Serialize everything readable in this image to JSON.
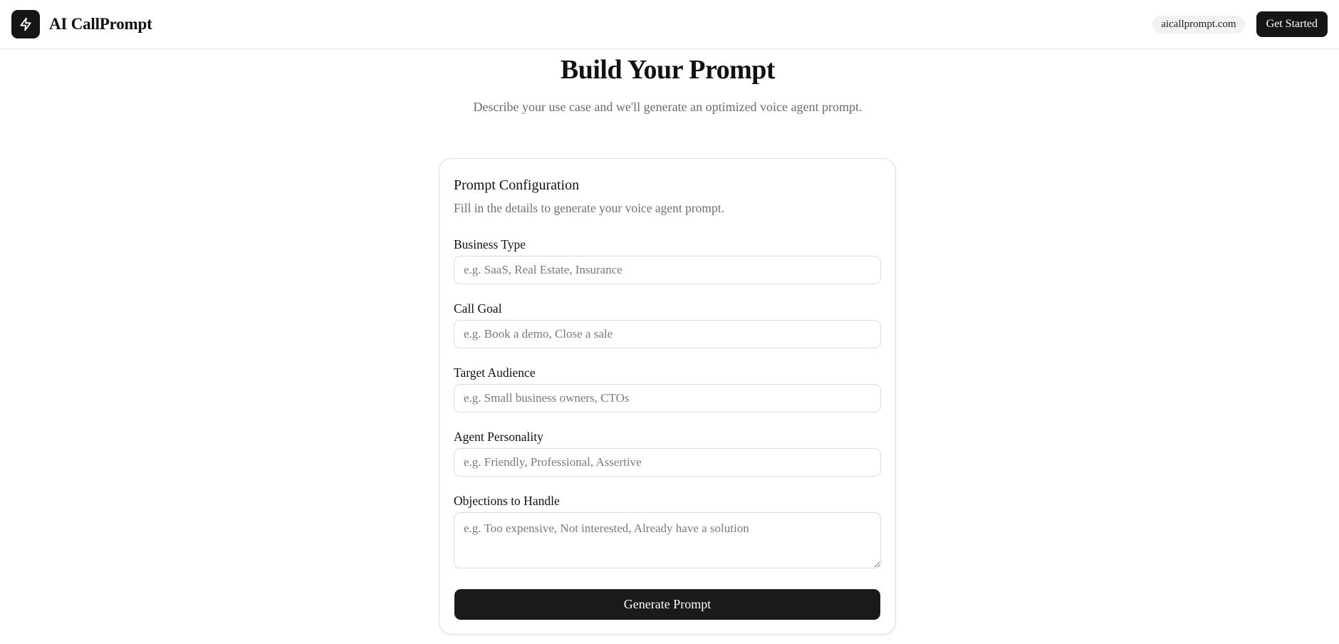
{
  "header": {
    "brand": "AI CallPrompt",
    "logo_icon": "lightning-bolt-icon",
    "domain": "aicallprompt.com",
    "cta_label": "Get Started"
  },
  "hero": {
    "title": "Build Your Prompt",
    "subtitle": "Describe your use case and we'll generate an optimized voice agent prompt."
  },
  "card": {
    "title": "Prompt Configuration",
    "description": "Fill in the details to generate your voice agent prompt.",
    "fields": [
      {
        "label": "Business Type",
        "placeholder": "e.g. SaaS, Real Estate, Insurance",
        "value": ""
      },
      {
        "label": "Call Goal",
        "placeholder": "e.g. Book a demo, Close a sale",
        "value": ""
      },
      {
        "label": "Target Audience",
        "placeholder": "e.g. Small business owners, CTOs",
        "value": ""
      },
      {
        "label": "Agent Personality",
        "placeholder": "e.g. Friendly, Professional, Assertive",
        "value": ""
      },
      {
        "label": "Objections to Handle",
        "placeholder": "e.g. Too expensive, Not interested, Already have a solution",
        "value": ""
      }
    ],
    "submit_label": "Generate Prompt"
  },
  "colors": {
    "primary": "#161616",
    "muted_text": "#6b6b6b",
    "border": "#dcdcdc",
    "pill_bg": "#f2f2f2"
  }
}
